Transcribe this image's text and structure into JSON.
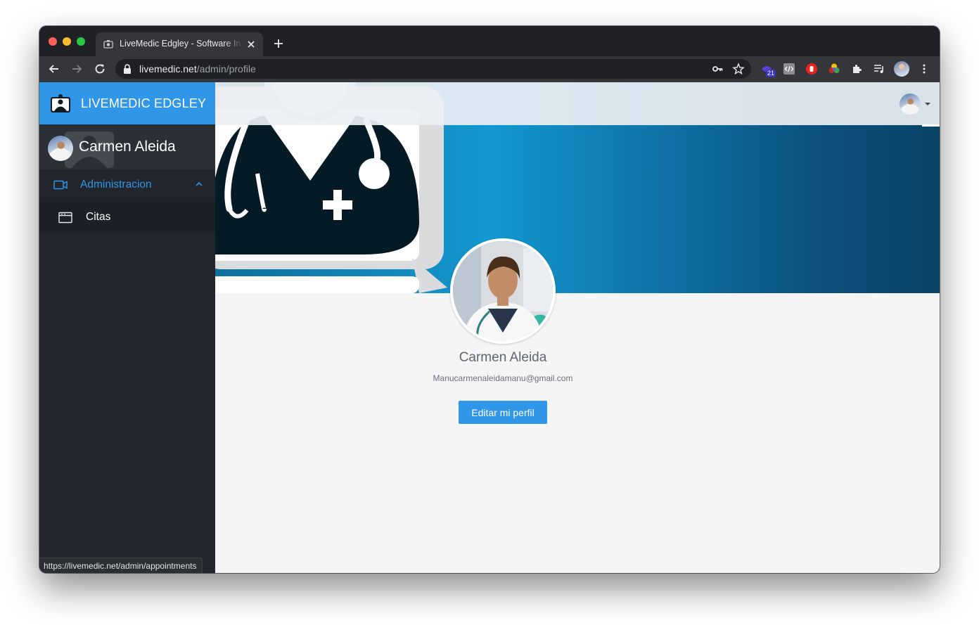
{
  "browser": {
    "tab_title": "LiveMedic Edgley - Software In",
    "url_host": "livemedic.net",
    "url_path": "/admin/profile",
    "extension_badge": "21",
    "status_url": "https://livemedic.net/admin/appointments"
  },
  "sidebar": {
    "brand": "LIVEMEDIC EDGLEY",
    "user_name": "Carmen Aleida",
    "menu": {
      "label": "Administracion",
      "items": [
        {
          "label": "Citas",
          "icon": "calendar-window-icon"
        }
      ]
    }
  },
  "profile": {
    "name": "Carmen Aleida",
    "email": "Manucarmenaleidamanu@gmail.com",
    "edit_button": "Editar mi perfil"
  },
  "colors": {
    "accent": "#2f96e8",
    "sidebar_bg": "#22252b",
    "banner_start": "#1398cf",
    "banner_end": "#0a4466"
  }
}
